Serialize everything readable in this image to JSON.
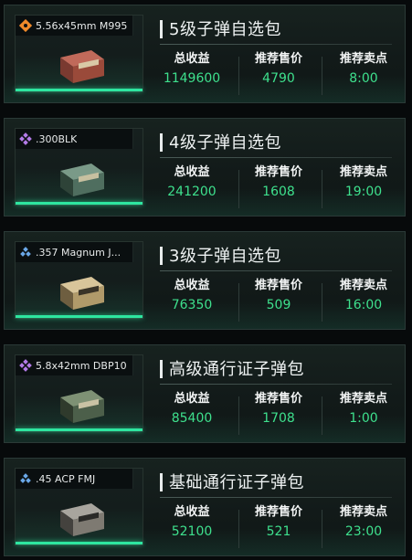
{
  "labels": {
    "total_revenue": "总收益",
    "recommended_price": "推荐售价",
    "recommended_sell_point": "推荐卖点"
  },
  "colors": {
    "value_green": "#3ee08d",
    "glow_green": "#2ee6a0",
    "rarity_orange": "#f08a2a",
    "rarity_purple": "#b37be8",
    "rarity_blue": "#6aa8e8"
  },
  "cards": [
    {
      "item_name": "5.56x45mm M995",
      "title": "5级子弹自选包",
      "total_revenue": "1149600",
      "recommended_price": "4790",
      "recommended_sell_point": "8:00",
      "rarity_icon": "orange-diamond-icon",
      "box_color": "#9a4a3a"
    },
    {
      "item_name": ".300BLK",
      "title": "4级子弹自选包",
      "total_revenue": "241200",
      "recommended_price": "1608",
      "recommended_sell_point": "19:00",
      "rarity_icon": "purple-diamond-icon",
      "box_color": "#4f6e5f"
    },
    {
      "item_name": ".357 Magnum J...",
      "title": "3级子弹自选包",
      "total_revenue": "76350",
      "recommended_price": "509",
      "recommended_sell_point": "16:00",
      "rarity_icon": "blue-diamond-icon",
      "box_color": "#b09a6a"
    },
    {
      "item_name": "5.8x42mm DBP10",
      "title": "高级通行证子弹包",
      "total_revenue": "85400",
      "recommended_price": "1708",
      "recommended_sell_point": "1:00",
      "rarity_icon": "purple-diamond-icon",
      "box_color": "#4c5f4a"
    },
    {
      "item_name": ".45 ACP FMJ",
      "title": "基础通行证子弹包",
      "total_revenue": "52100",
      "recommended_price": "521",
      "recommended_sell_point": "23:00",
      "rarity_icon": "blue-diamond-icon",
      "box_color": "#7e7a72"
    }
  ]
}
